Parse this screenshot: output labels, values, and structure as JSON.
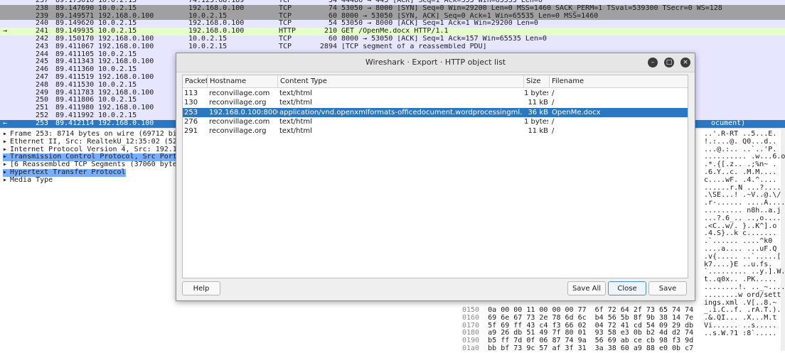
{
  "packets": [
    {
      "no": "237",
      "time": "89.175016",
      "src": "10.0.2.15",
      "dst": "74.125.68.189",
      "proto": "TCP",
      "len": "54",
      "info": "44486 → 443 [ACK] Seq=1 Ack=355 Win=65535 Len=0",
      "style": "normal"
    },
    {
      "no": "238",
      "time": "89.147690",
      "src": "10.0.2.15",
      "dst": "192.168.0.100",
      "proto": "TCP",
      "len": "74",
      "info": "53050 → 8000 [SYN] Seq=0 Win=29200 Len=0 MSS=1460 SACK_PERM=1 TSval=539300 TSecr=0 WS=128",
      "style": "gray"
    },
    {
      "no": "239",
      "time": "89.149571",
      "src": "192.168.0.100",
      "dst": "10.0.2.15",
      "proto": "TCP",
      "len": "60",
      "info": "8000 → 53050 [SYN, ACK] Seq=0 Ack=1 Win=65535 Len=0 MSS=1460",
      "style": "gray"
    },
    {
      "no": "240",
      "time": "89.149620",
      "src": "10.0.2.15",
      "dst": "192.168.0.100",
      "proto": "TCP",
      "len": "54",
      "info": "53050 → 8000 [ACK] Seq=1 Ack=1 Win=29200 Len=0",
      "style": "normal"
    },
    {
      "no": "241",
      "time": "89.149935",
      "src": "10.0.2.15",
      "dst": "192.168.0.100",
      "proto": "HTTP",
      "len": "210",
      "info": "GET /OpenMe.docx HTTP/1.1",
      "style": "http",
      "mark": "→"
    },
    {
      "no": "242",
      "time": "89.150170",
      "src": "192.168.0.100",
      "dst": "10.0.2.15",
      "proto": "TCP",
      "len": "60",
      "info": "8000 → 53050 [ACK] Seq=1 Ack=157 Win=65535 Len=0",
      "style": "normal"
    },
    {
      "no": "243",
      "time": "89.411067",
      "src": "192.168.0.100",
      "dst": "10.0.2.15",
      "proto": "TCP",
      "len": "2894",
      "info": "[TCP segment of a reassembled PDU]",
      "style": "normal"
    },
    {
      "no": "244",
      "time": "89.411105",
      "src": "10.0.2.15",
      "dst": "",
      "proto": "",
      "len": "",
      "info": "",
      "style": "normal"
    },
    {
      "no": "245",
      "time": "89.411343",
      "src": "192.168.0.100",
      "dst": "",
      "proto": "",
      "len": "",
      "info": "",
      "style": "normal"
    },
    {
      "no": "246",
      "time": "89.411360",
      "src": "10.0.2.15",
      "dst": "",
      "proto": "",
      "len": "",
      "info": "",
      "style": "normal"
    },
    {
      "no": "247",
      "time": "89.411519",
      "src": "192.168.0.100",
      "dst": "",
      "proto": "",
      "len": "",
      "info": "",
      "style": "normal"
    },
    {
      "no": "248",
      "time": "89.411530",
      "src": "10.0.2.15",
      "dst": "",
      "proto": "",
      "len": "",
      "info": "",
      "style": "normal"
    },
    {
      "no": "249",
      "time": "89.411783",
      "src": "192.168.0.100",
      "dst": "",
      "proto": "",
      "len": "",
      "info": "",
      "style": "normal"
    },
    {
      "no": "250",
      "time": "89.411806",
      "src": "10.0.2.15",
      "dst": "",
      "proto": "",
      "len": "",
      "info": "",
      "style": "normal"
    },
    {
      "no": "251",
      "time": "89.411980",
      "src": "192.168.0.100",
      "dst": "",
      "proto": "",
      "len": "",
      "info": "",
      "style": "normal"
    },
    {
      "no": "252",
      "time": "89.411992",
      "src": "10.0.2.15",
      "dst": "",
      "proto": "",
      "len": "",
      "info": "",
      "style": "normal"
    },
    {
      "no": "253",
      "time": "89.412114",
      "src": "192.168.0.100",
      "dst": "",
      "proto": "",
      "len": "",
      "info": "",
      "style": "selected",
      "mark": "←",
      "tail": "ocument)"
    }
  ],
  "details": [
    {
      "arrow": "▸",
      "text": "Frame 253: 8714 bytes on wire (69712 bi",
      "hl": false
    },
    {
      "arrow": "▸",
      "text": "Ethernet II, Src: RealtekU_12:35:02 (52",
      "hl": false
    },
    {
      "arrow": "▸",
      "text": "Internet Protocol Version 4, Src: 192.1",
      "hl": false
    },
    {
      "arrow": "▸",
      "text": "Transmission Control Protocol, Src Port",
      "hl": true
    },
    {
      "arrow": "▸",
      "text": "[6 Reassembled TCP Segments (37060 byte",
      "hl": false
    },
    {
      "arrow": "▸",
      "text": "Hypertext Transfer Protocol",
      "hl": true
    },
    {
      "arrow": "▸",
      "text": "Media Type",
      "hl": false
    }
  ],
  "ascii": [
    "..'.R-RT ..5...E.",
    "!.:...@. Q0...d..",
    "...@.:.. ..`..'P.",
    ".......... .w...6.o",
    ".*.{[.z.. .;%n~ .",
    ".6.Y..c. .M.M....",
    "c....wF. .4.^....",
    "......r.N ...?....",
    ".\\SE...! .~V..@.\\/",
    ".r-...... ....A....",
    "......... n8h..a.j",
    "...?.6_.. ..,o....",
    ".<C..w/. }..K^].o",
    ".4.S}..k c.......",
    ".`...... ....^k0",
    "....a.... ...uF.Q",
    ".v{..... ..`.....[",
    "k7....}E ..u.fs.",
    "`......... ..y.].W.",
    "t..q0x.. .PK.....",
    "........!. .._~....",
    "........w ord/sett",
    "ings.xml .V[..8.~",
    "_.i.C..f. .rA.T.).",
    ".&.QI... .X...M.t",
    "Vi...... ..s.....",
    "..s.W.?1 :8`....."
  ],
  "hex": [
    {
      "off": "0150",
      "bytes": "0a 00 00 11 00 00 00 77  6f 72 64 2f 73 65 74 74"
    },
    {
      "off": "0160",
      "bytes": "69 6e 67 73 2e 78 6d 6c  b4 56 5b 8f 9b 38 14 7e"
    },
    {
      "off": "0170",
      "bytes": "5f 69 ff 43 c4 f3 66 02  04 72 41 cd 54 09 29 db"
    },
    {
      "off": "0180",
      "bytes": "a9 26 db 51 49 7f 80 01  93 58 e3 0b b2 4d d2 74"
    },
    {
      "off": "0190",
      "bytes": "b5 ff 7d 0f 06 87 74 9a  56 69 ab ce cb 98 f3 9d"
    },
    {
      "off": "01a0",
      "bytes": "bb bf 73 9c 57 af 3f 31  3a 38 60 a9 88 e0 0b c7"
    }
  ],
  "dialog": {
    "title": "Wireshark · Export · HTTP object list",
    "columns": {
      "packet": "Packet",
      "hostname": "Hostname",
      "content_type": "Content Type",
      "size": "Size",
      "filename": "Filename"
    },
    "rows": [
      {
        "packet": "113",
        "hostname": "reconvillage.com",
        "content_type": "text/html",
        "size": "1 bytes",
        "filename": "/"
      },
      {
        "packet": "130",
        "hostname": "reconvillage.org",
        "content_type": "text/html",
        "size": "11 kB",
        "filename": "/"
      },
      {
        "packet": "253",
        "hostname": "192.168.0.100:8000",
        "content_type": "application/vnd.openxmlformats-officedocument.wordprocessingml.document",
        "size": "36 kB",
        "filename": "OpenMe.docx"
      },
      {
        "packet": "276",
        "hostname": "reconvillage.com",
        "content_type": "text/html",
        "size": "1 bytes",
        "filename": "/"
      },
      {
        "packet": "291",
        "hostname": "reconvillage.org",
        "content_type": "text/html",
        "size": "11 kB",
        "filename": "/"
      }
    ],
    "selected_index": 2,
    "buttons": {
      "help": "Help",
      "save_all": "Save All",
      "close": "Close",
      "save": "Save"
    }
  },
  "colors": {
    "selection": "#2a78c4",
    "http_row": "#e4ffc7",
    "tcp_row": "#e7e6ff",
    "gray_row": "#a0a0a0"
  }
}
